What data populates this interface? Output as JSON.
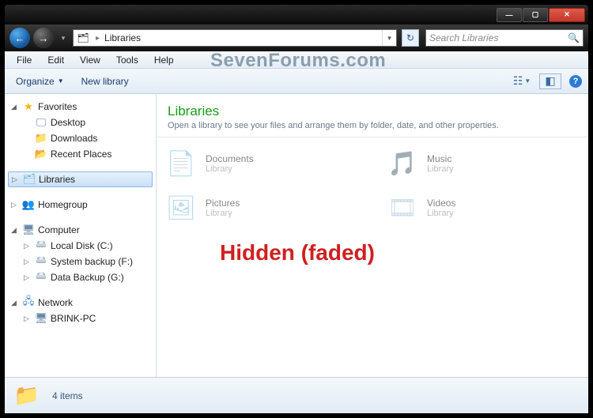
{
  "titlebar": {
    "min": "—",
    "max": "▢",
    "close": "✕"
  },
  "address": {
    "path": "Libraries",
    "search_placeholder": "Search Libraries"
  },
  "menubar": {
    "file": "File",
    "edit": "Edit",
    "view": "View",
    "tools": "Tools",
    "help": "Help"
  },
  "watermark": "SevenForums.com",
  "toolbar": {
    "organize": "Organize",
    "new_library": "New library"
  },
  "nav": {
    "favorites": {
      "label": "Favorites",
      "items": [
        {
          "label": "Desktop"
        },
        {
          "label": "Downloads"
        },
        {
          "label": "Recent Places"
        }
      ]
    },
    "libraries": {
      "label": "Libraries"
    },
    "homegroup": {
      "label": "Homegroup"
    },
    "computer": {
      "label": "Computer",
      "items": [
        {
          "label": "Local Disk (C:)"
        },
        {
          "label": "System backup (F:)"
        },
        {
          "label": "Data Backup (G:)"
        }
      ]
    },
    "network": {
      "label": "Network",
      "items": [
        {
          "label": "BRINK-PC"
        }
      ]
    }
  },
  "content": {
    "title": "Libraries",
    "subtitle": "Open a library to see your files and arrange them by folder, date, and other properties.",
    "item_sub": "Library",
    "items": {
      "documents": "Documents",
      "music": "Music",
      "pictures": "Pictures",
      "videos": "Videos"
    },
    "overlay": "Hidden (faded)"
  },
  "status": {
    "count": "4 items"
  }
}
